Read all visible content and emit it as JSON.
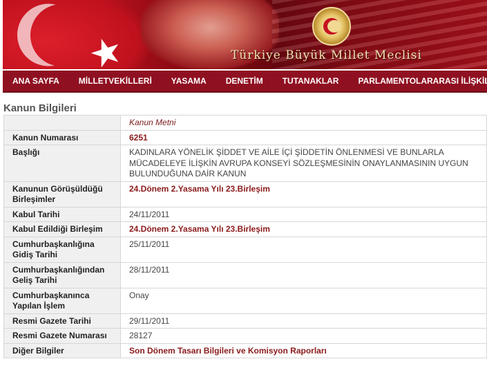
{
  "header": {
    "title": "Türkiye Büyük Millet Meclisi"
  },
  "nav": {
    "items": [
      "ANA SAYFA",
      "MİLLETVEKİLLERİ",
      "YASAMA",
      "DENETİM",
      "TUTANAKLAR",
      "PARLAMENTOLARARASI İLİŞKİLER"
    ]
  },
  "page": {
    "title": "Kanun Bilgileri"
  },
  "table": {
    "text_link": "Kanun Metni",
    "rows": [
      {
        "label": "Kanun Numarası",
        "value": "6251",
        "style": "link"
      },
      {
        "label": "Başlığı",
        "value": "KADINLARA YÖNELİK ŞİDDET VE AİLE İÇİ ŞİDDETİN ÖNLENMESİ VE BUNLARLA MÜCADELEYE İLİŞKİN AVRUPA KONSEYİ SÖZLEŞMESİNİN ONAYLANMASININ UYGUN BULUNDUĞUNA DAİR KANUN",
        "style": "plain"
      },
      {
        "label": "Kanunun Görüşüldüğü Birleşimler",
        "value": "24.Dönem 2.Yasama Yılı 23.Birleşim",
        "style": "link"
      },
      {
        "label": "Kabul Tarihi",
        "value": "24/11/2011",
        "style": "plain"
      },
      {
        "label": "Kabul Edildiği Birleşim",
        "value": "24.Dönem 2.Yasama Yılı 23.Birleşim",
        "style": "link"
      },
      {
        "label": "Cumhurbaşkanlığına Gidiş Tarihi",
        "value": "25/11/2011",
        "style": "plain"
      },
      {
        "label": "Cumhurbaşkanlığından Geliş Tarihi",
        "value": "28/11/2011",
        "style": "plain"
      },
      {
        "label": "Cumhurbaşkanınca Yapılan İşlem",
        "value": "Onay",
        "style": "plain"
      },
      {
        "label": "Resmi Gazete Tarihi",
        "value": "29/11/2011",
        "style": "plain"
      },
      {
        "label": "Resmi Gazete Numarası",
        "value": "28127",
        "style": "plain"
      },
      {
        "label": "Diğer Bilgiler",
        "value": "Son Dönem Tasarı Bilgileri ve Komisyon Raporları",
        "style": "link"
      }
    ]
  },
  "colors": {
    "nav_bg": "#8f1021",
    "link": "#8b1a1a",
    "label_bg": "#f0f0f0"
  }
}
